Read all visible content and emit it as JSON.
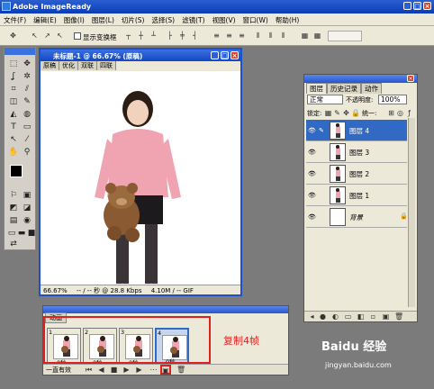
{
  "app": {
    "title": "Adobe ImageReady"
  },
  "menu": [
    "文件(F)",
    "编辑(E)",
    "图像(I)",
    "图层(L)",
    "切片(S)",
    "选择(S)",
    "滤镜(T)",
    "视图(V)",
    "窗口(W)",
    "帮助(H)"
  ],
  "options": {
    "show_bounding_box": "显示变换框"
  },
  "document": {
    "title": "未标题-1 @ 66.67% (原稿)",
    "tabs": [
      "原稿",
      "优化",
      "双联",
      "四联"
    ],
    "zoom": "66.67%",
    "time": "-- / -- 秒 @ 28.8 Kbps",
    "size": "4.10M / -- GIF"
  },
  "layers_panel": {
    "tabs": [
      "图层",
      "历史记录",
      "动作"
    ],
    "blend_mode": "正常",
    "opacity_label": "不透明度:",
    "opacity_value": "100%",
    "lock_label": "锁定:",
    "unify_label": "统一:",
    "layers": [
      {
        "name": "图层 4",
        "selected": true
      },
      {
        "name": "图层 3",
        "selected": false
      },
      {
        "name": "图层 2",
        "selected": false
      },
      {
        "name": "图层 1",
        "selected": false
      },
      {
        "name": "背景",
        "selected": false
      }
    ]
  },
  "animation_panel": {
    "tab": "动画",
    "frames": [
      {
        "num": "1",
        "delay": "0秒"
      },
      {
        "num": "2",
        "delay": "0秒"
      },
      {
        "num": "3",
        "delay": "0秒"
      },
      {
        "num": "4",
        "delay": "0秒"
      }
    ],
    "loop": "一直有效"
  },
  "annotation": {
    "text": "复制4帧",
    "color": "#e02020"
  },
  "watermark": {
    "brand": "Baidu 经验",
    "url": "jingyan.baidu.com"
  }
}
